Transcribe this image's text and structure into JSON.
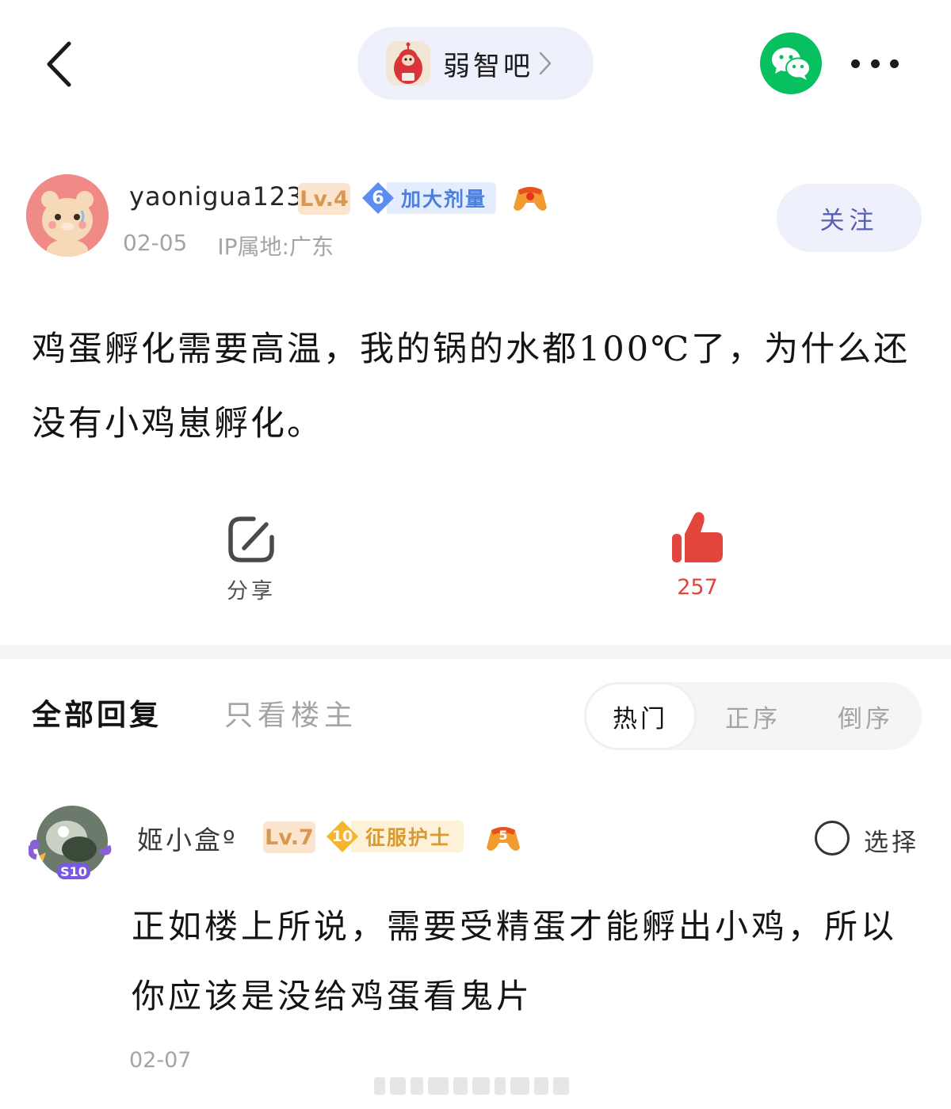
{
  "forum": {
    "name": "弱智吧"
  },
  "author": {
    "username": "yaonigua123",
    "level": "Lv.4",
    "title_level": "6",
    "title": "加大剂量",
    "date": "02-05",
    "ip": "IP属地:广东",
    "follow_label": "关注"
  },
  "post": {
    "text": "鸡蛋孵化需要高温，我的锅的水都100℃了，为什么还没有小鸡崽孵化。"
  },
  "actions": {
    "share_label": "分享",
    "like_count": "257"
  },
  "replies_header": {
    "all_tab": "全部回复",
    "op_only_tab": "只看楼主",
    "sort_options": [
      "热门",
      "正序",
      "倒序"
    ]
  },
  "reply": {
    "username": "姬小盒º",
    "level": "Lv.7",
    "title_level": "10",
    "title": "征服护士",
    "select_label": "选择",
    "text": "正如楼上所说，需要受精蛋才能孵出小鸡，所以你应该是没给鸡蛋看鬼片",
    "date": "02-07",
    "avatar_tag": "S10",
    "fan_badge": "5"
  },
  "colors": {
    "like": "#e2453c",
    "wechat": "#07c160",
    "follow_text": "#5a5fb4",
    "level_bg": "#fbe5cf"
  }
}
